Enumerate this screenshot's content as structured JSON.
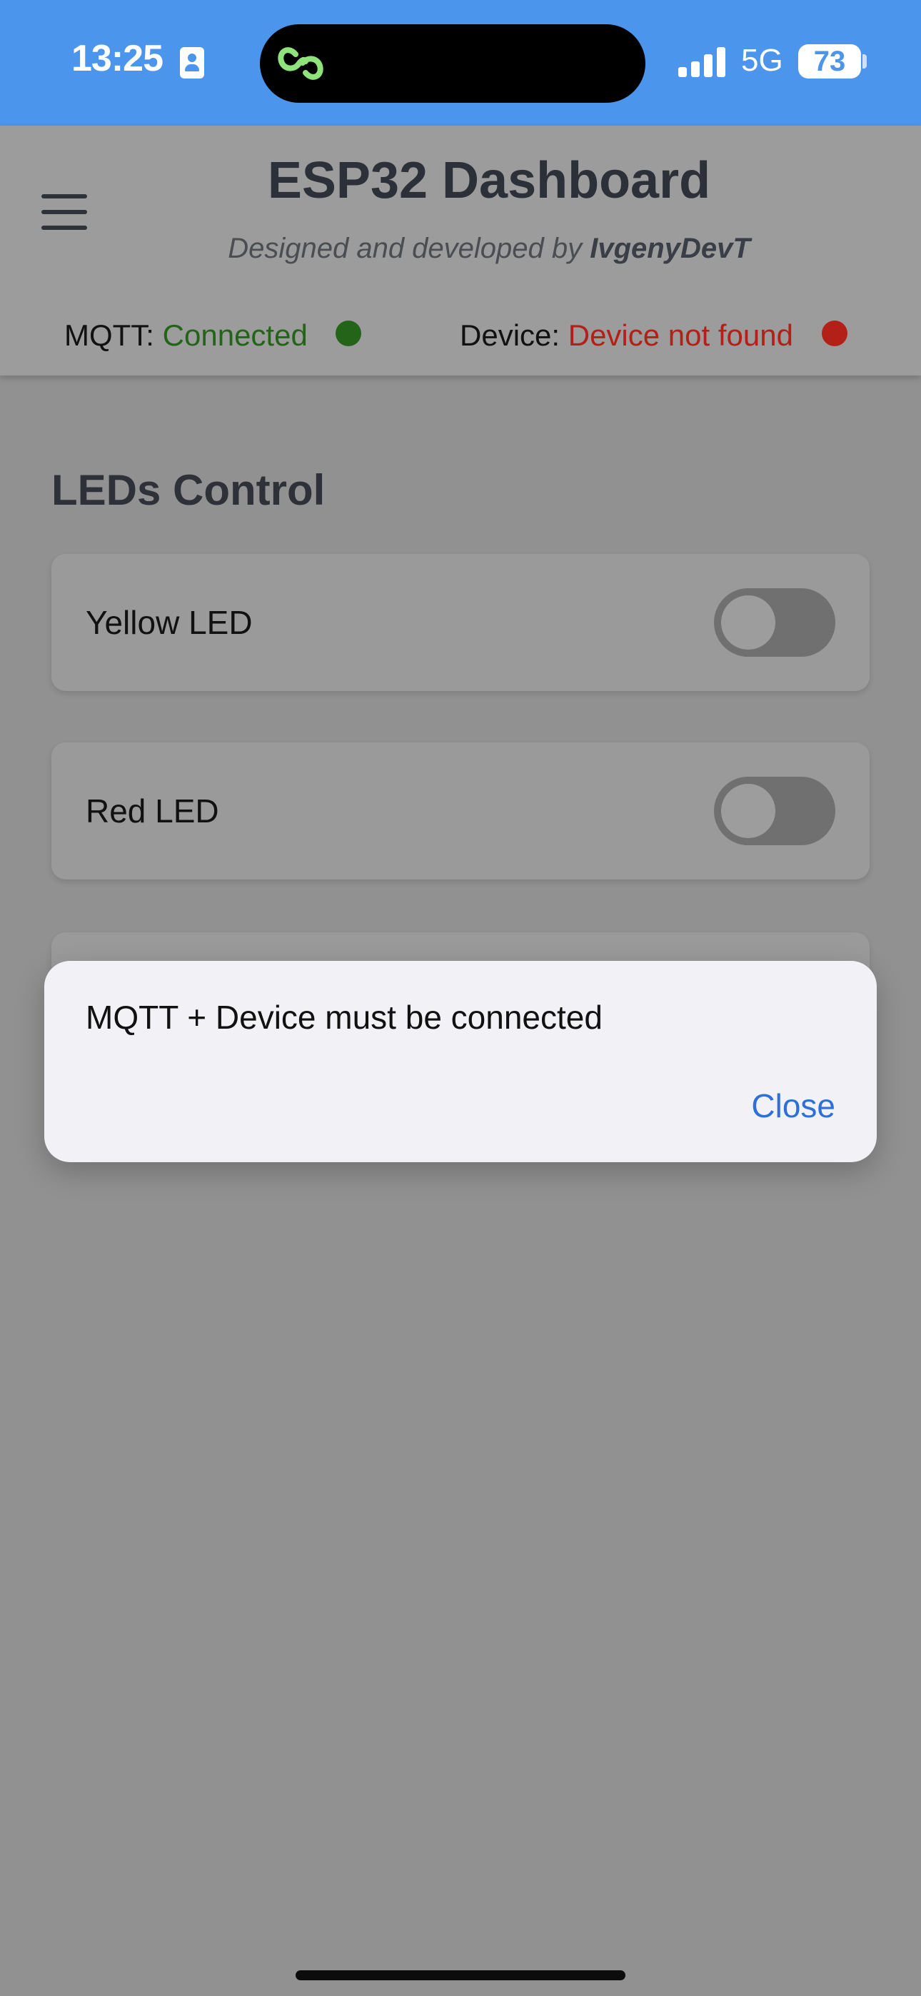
{
  "status_bar": {
    "time": "13:25",
    "network": "5G",
    "battery": "73",
    "icons": [
      "id-card-icon",
      "link-icon",
      "signal-icon",
      "battery-icon"
    ]
  },
  "header": {
    "title": "ESP32 Dashboard",
    "subtitle_prefix": "Designed and developed by",
    "subtitle_author": "IvgenyDevT",
    "menu_icon": "hamburger-icon"
  },
  "connection": {
    "mqtt_label": "MQTT:",
    "mqtt_status": "Connected",
    "mqtt_color": "#236418",
    "device_label": "Device:",
    "device_status": "Device not found",
    "device_color": "#b22018"
  },
  "leds": {
    "title": "LEDs Control",
    "items": [
      {
        "label": "Yellow LED",
        "on": false
      },
      {
        "label": "Red LED",
        "on": false
      }
    ]
  },
  "alert": {
    "message": "MQTT + Device must be connected",
    "close_label": "Close"
  },
  "colors": {
    "status_bar": "#4b95ec",
    "accent": "#2c70d8"
  }
}
